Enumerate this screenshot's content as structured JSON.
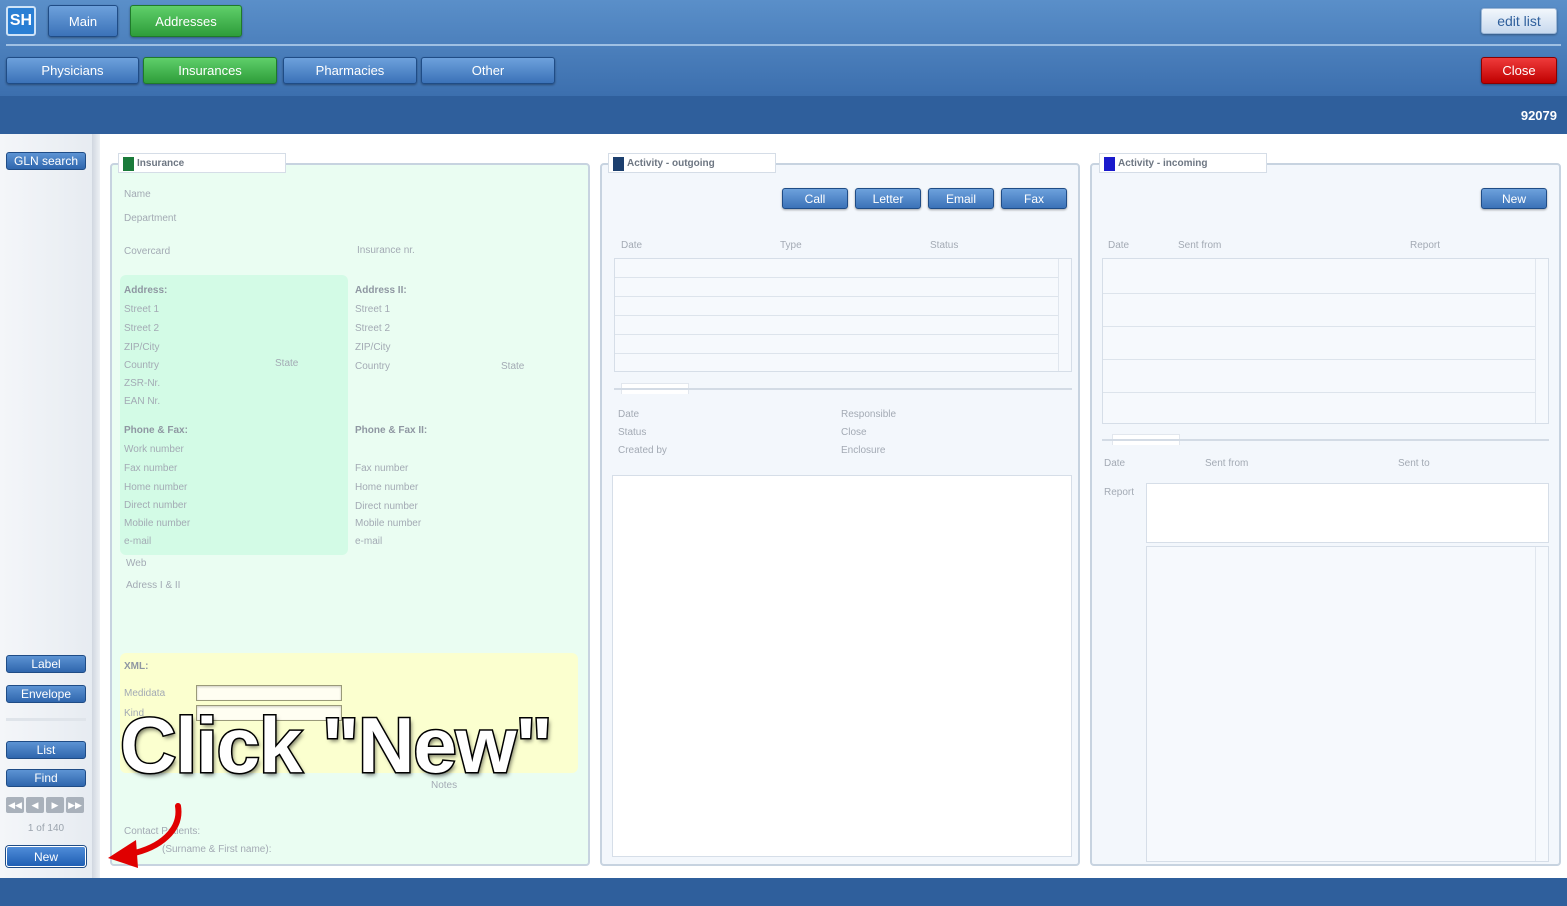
{
  "app": {
    "logo": "SH"
  },
  "top_nav": {
    "main": "Main",
    "addresses": "Addresses",
    "edit_list": "edit list"
  },
  "sub_nav": {
    "tabs": [
      "Physicians",
      "Insurances",
      "Pharmacies",
      "Other"
    ],
    "close": "Close"
  },
  "record_number": "92079",
  "sidebar": {
    "gln_search": "GLN search",
    "label": "Label",
    "envelope": "Envelope",
    "list": "List",
    "find": "Find",
    "page_count": "1 of 140",
    "new": "New"
  },
  "insurance_panel": {
    "title": "Insurance",
    "name": "Name",
    "department": "Department",
    "covercard": "Covercard",
    "insurance_nr": "Insurance nr.",
    "address_title": "Address:",
    "street1": "Street 1",
    "street2": "Street 2",
    "zip_city": "ZIP/City",
    "country": "Country",
    "state": "State",
    "zsr": "ZSR-Nr.",
    "ean": "EAN Nr.",
    "address2_title": "Address II:",
    "phone_title": "Phone & Fax:",
    "phone2_title": "Phone & Fax II:",
    "work_number": "Work number",
    "fax_number": "Fax number",
    "home_number": "Home number",
    "direct_number": "Direct number",
    "mobile_number": "Mobile number",
    "email": "e-mail",
    "web": "Web",
    "address_i_ii": "Adress I & II",
    "xml_title": "XML:",
    "medidata": "Medidata",
    "kind": "Kind",
    "notes": "Notes",
    "contact_patients": "Contact Patients:",
    "surname_first": "(Surname & First name):"
  },
  "outgoing_panel": {
    "title": "Activity - outgoing",
    "buttons": [
      "Call",
      "Letter",
      "Email",
      "Fax"
    ],
    "columns": [
      "Date",
      "Type",
      "Status"
    ],
    "detail_left": [
      "Date",
      "Status",
      "Created by"
    ],
    "detail_right": [
      "Responsible",
      "Close",
      "Enclosure"
    ]
  },
  "incoming_panel": {
    "title": "Activity - incoming",
    "new_button": "New",
    "columns": [
      "Date",
      "Sent from",
      "Report"
    ],
    "detail": [
      "Date",
      "Sent from",
      "Sent to"
    ],
    "report": "Report"
  },
  "annotation": {
    "text": "Click \"New\""
  },
  "colors": {
    "accent_blue": "#3c6fae",
    "active_green": "#2e9d3a",
    "close_red": "#c00000",
    "insurance_bg": "#eafdf2",
    "address_bg": "#d3fbe6",
    "xml_bg": "#fbffcf",
    "annotation_arrow": "#e00000"
  }
}
